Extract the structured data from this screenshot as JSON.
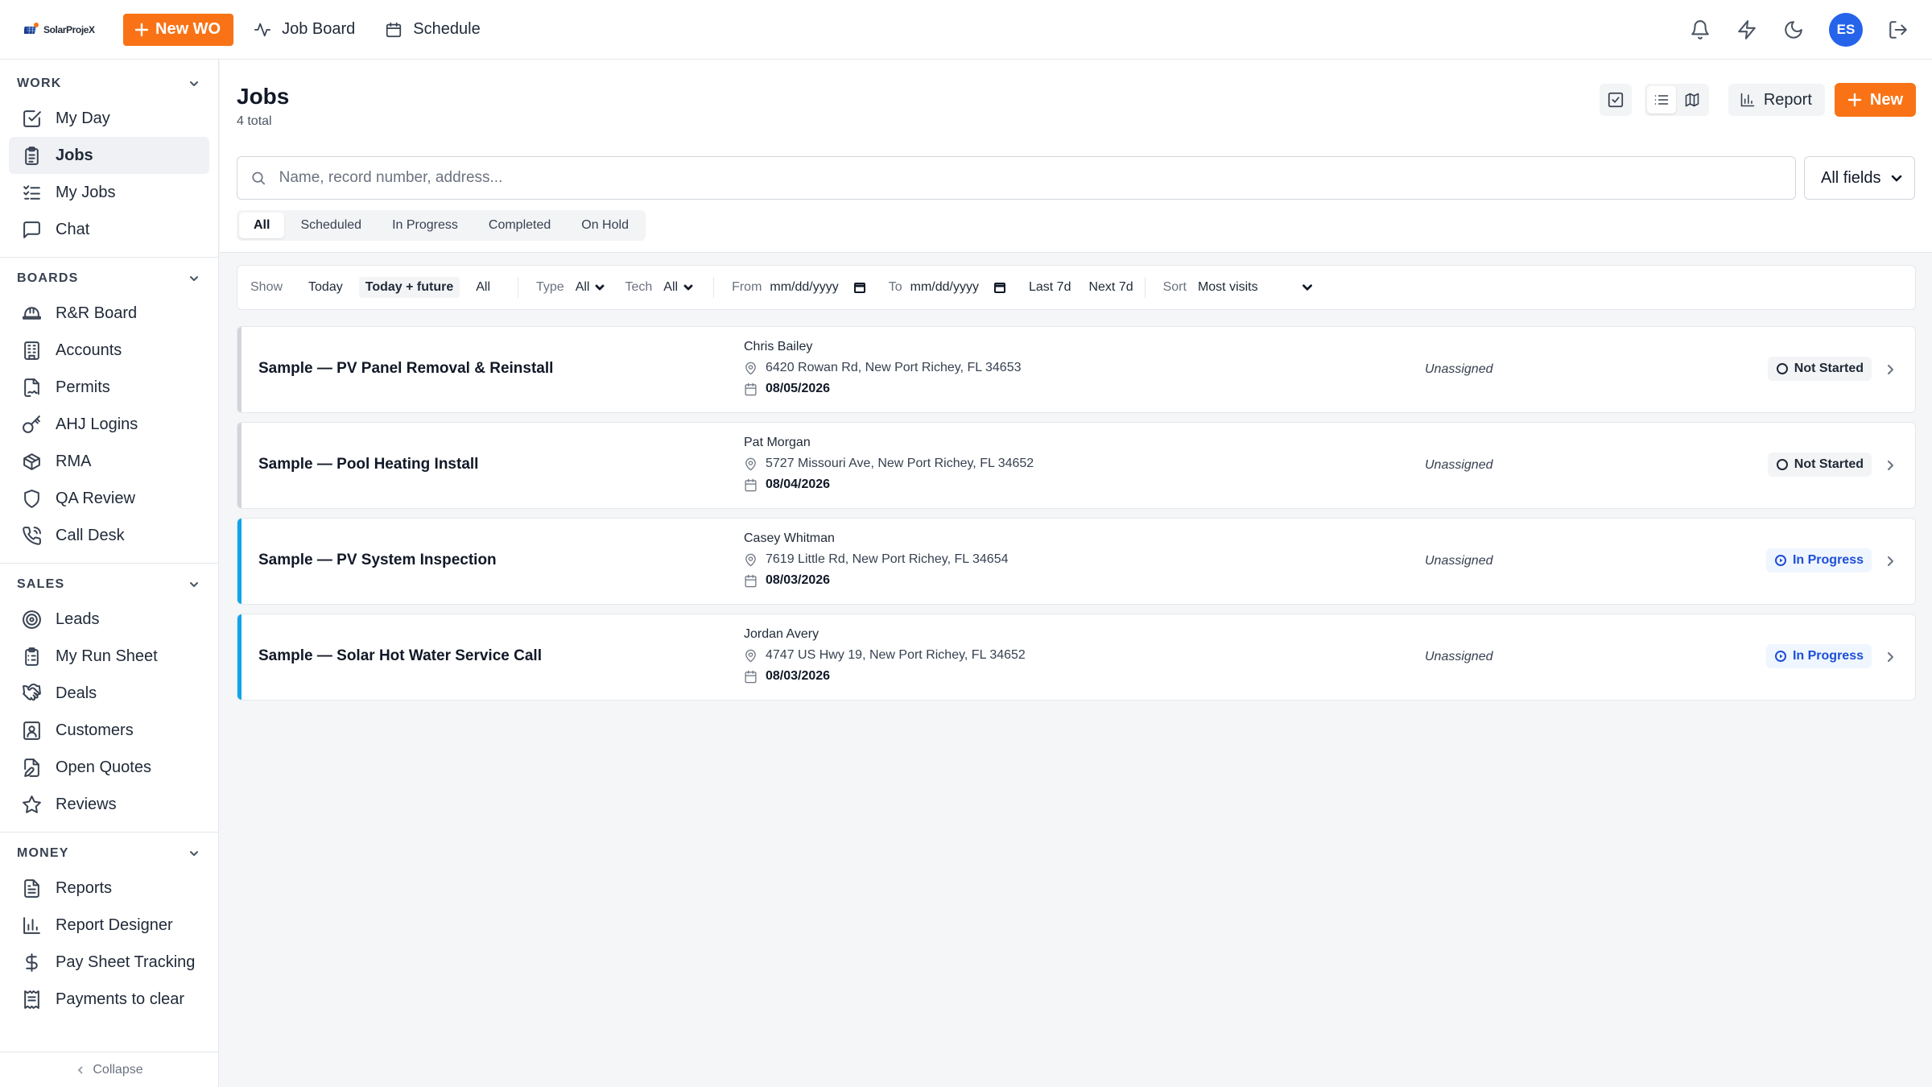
{
  "brand": {
    "name": "SolarProjeX",
    "accent": "#f97316",
    "progress_color": "#0ea5e9"
  },
  "topbar": {
    "new_wo_label": "New WO",
    "nav": [
      {
        "label": "Job Board",
        "icon": "activity-icon"
      },
      {
        "label": "Schedule",
        "icon": "calendar-icon"
      }
    ],
    "avatar_initials": "ES",
    "icons": [
      "bell-icon",
      "lightning-icon",
      "moon-icon",
      "logout-icon"
    ]
  },
  "sidebar": {
    "sections": [
      {
        "title": "WORK",
        "items": [
          {
            "label": "My Day",
            "icon": "checkbox-icon"
          },
          {
            "label": "Jobs",
            "icon": "clipboard-icon",
            "active": true
          },
          {
            "label": "My Jobs",
            "icon": "list-check-icon"
          },
          {
            "label": "Chat",
            "icon": "chat-icon"
          }
        ]
      },
      {
        "title": "BOARDS",
        "items": [
          {
            "label": "R&R Board",
            "icon": "hardhat-icon"
          },
          {
            "label": "Accounts",
            "icon": "building-icon"
          },
          {
            "label": "Permits",
            "icon": "file-signature-icon"
          },
          {
            "label": "AHJ Logins",
            "icon": "key-icon"
          },
          {
            "label": "RMA",
            "icon": "package-icon"
          },
          {
            "label": "QA Review",
            "icon": "shield-icon"
          },
          {
            "label": "Call Desk",
            "icon": "phone-icon"
          }
        ]
      },
      {
        "title": "SALES",
        "items": [
          {
            "label": "Leads",
            "icon": "target-icon"
          },
          {
            "label": "My Run Sheet",
            "icon": "clipboard-list-icon"
          },
          {
            "label": "Deals",
            "icon": "handshake-icon"
          },
          {
            "label": "Customers",
            "icon": "contact-icon"
          },
          {
            "label": "Open Quotes",
            "icon": "file-edit-icon"
          },
          {
            "label": "Reviews",
            "icon": "star-icon"
          }
        ]
      },
      {
        "title": "MONEY",
        "items": [
          {
            "label": "Reports",
            "icon": "file-text-icon"
          },
          {
            "label": "Report Designer",
            "icon": "bar-chart-icon"
          },
          {
            "label": "Pay Sheet Tracking",
            "icon": "dollar-icon"
          },
          {
            "label": "Payments to clear",
            "icon": "receipt-icon"
          }
        ]
      }
    ],
    "collapse_label": "Collapse"
  },
  "main": {
    "title": "Jobs",
    "subtitle": "4 total",
    "report_label": "Report",
    "new_label": "New",
    "search_placeholder": "Name, record number, address...",
    "field_select": "All fields",
    "tabs": [
      "All",
      "Scheduled",
      "In Progress",
      "Completed",
      "On Hold"
    ],
    "active_tab": "All"
  },
  "filters": {
    "show_label": "Show",
    "show_options": [
      "Today",
      "Today + future",
      "All"
    ],
    "show_selected": "Today + future",
    "type_label": "Type",
    "type_value": "All",
    "tech_label": "Tech",
    "tech_value": "All",
    "from_label": "From",
    "from_value": "mm/dd/yyyy",
    "to_label": "To",
    "to_value": "mm/dd/yyyy",
    "last7": "Last 7d",
    "next7": "Next 7d",
    "sort_label": "Sort",
    "sort_value": "Most visits"
  },
  "jobs": [
    {
      "title": "Sample — PV Panel Removal & Reinstall",
      "customer": "Chris Bailey",
      "address": "6420 Rowan Rd, New Port Richey, FL 34653",
      "date": "08/05/2026",
      "assignee": "Unassigned",
      "status": "Not Started",
      "status_kind": "ns"
    },
    {
      "title": "Sample — Pool Heating Install",
      "customer": "Pat Morgan",
      "address": "5727 Missouri Ave, New Port Richey, FL 34652",
      "date": "08/04/2026",
      "assignee": "Unassigned",
      "status": "Not Started",
      "status_kind": "ns"
    },
    {
      "title": "Sample — PV System Inspection",
      "customer": "Casey Whitman",
      "address": "7619 Little Rd, New Port Richey, FL 34654",
      "date": "08/03/2026",
      "assignee": "Unassigned",
      "status": "In Progress",
      "status_kind": "ip"
    },
    {
      "title": "Sample — Solar Hot Water Service Call",
      "customer": "Jordan Avery",
      "address": "4747 US Hwy 19, New Port Richey, FL 34652",
      "date": "08/03/2026",
      "assignee": "Unassigned",
      "status": "In Progress",
      "status_kind": "ip"
    }
  ]
}
